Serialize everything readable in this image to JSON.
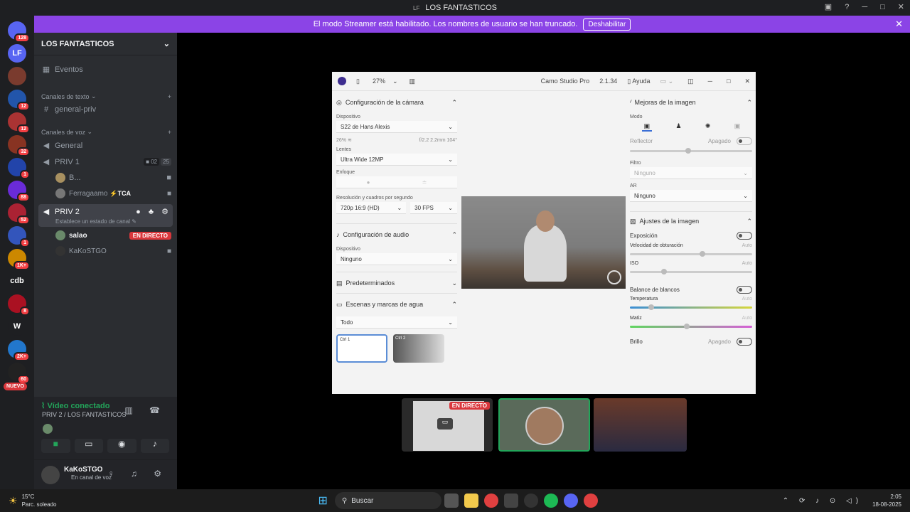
{
  "window": {
    "logo": "LF",
    "title": "LOS FANTASTICOS"
  },
  "banner": {
    "text": "El modo Streamer está habilitado. Los nombres de usuario se han truncado.",
    "button": "Deshabilitar"
  },
  "servers": [
    {
      "label": "",
      "badge": "128",
      "color": "#5865f2"
    },
    {
      "label": "LF",
      "badge": "",
      "color": "#5865f2"
    },
    {
      "label": "",
      "badge": "",
      "color": "#7a3b2e"
    },
    {
      "label": "",
      "badge": "12",
      "color": "#2255aa"
    },
    {
      "label": "",
      "badge": "12",
      "color": "#aa3333"
    },
    {
      "label": "",
      "badge": "32",
      "color": "#883322"
    },
    {
      "label": "",
      "badge": "1",
      "color": "#2244aa"
    },
    {
      "label": "",
      "badge": "88",
      "color": "#6a2bd8"
    },
    {
      "label": "",
      "badge": "52",
      "color": "#aa2233"
    },
    {
      "label": "",
      "badge": "1",
      "color": "#3355bb"
    },
    {
      "label": "",
      "badge": "1K+",
      "color": "#cc8800"
    },
    {
      "label": "cdb",
      "badge": "",
      "color": "#1e1f22"
    },
    {
      "label": "",
      "badge": "8",
      "color": "#aa1122"
    },
    {
      "label": "W",
      "badge": "",
      "color": "#1e1f22"
    },
    {
      "label": "",
      "badge": "2K+",
      "color": "#2277cc"
    },
    {
      "label": "",
      "badge": "60",
      "color": "#222"
    }
  ],
  "nuevo": "NUEVO",
  "sidebar": {
    "server_name": "LOS FANTASTICOS",
    "events": "Eventos",
    "text_cat": "Canales de texto",
    "text_channel": "general-priv",
    "voice_cat": "Canales de voz",
    "voice_general": "General",
    "priv1": "PRIV 1",
    "priv1_count": "02",
    "priv1_limit": "25",
    "priv1_user1": "B...",
    "priv1_user2": "Ferragaamo",
    "priv1_user2_tag": "TCA",
    "priv2": "PRIV 2",
    "priv2_status": "Establece un estado de canal",
    "priv2_user1": "salao",
    "live": "EN DIRECTO",
    "priv2_user2": "KaKoSTGO"
  },
  "voice_panel": {
    "status": "Vídeo conectado",
    "channel": "PRIV 2 / LOS FANTASTICOS"
  },
  "user": {
    "name": "KaKoSTGO",
    "status": "En canal de voz"
  },
  "camo": {
    "zoom": "27%",
    "app": "Camo Studio Pro",
    "version": "2.1.34",
    "help": "Ayuda",
    "camera_section": "Configuración de la cámara",
    "device_label": "Dispositivo",
    "device": "S22 de Hans Alexis",
    "battery": "26%",
    "optics": "f/2.2 2.2mm 104°",
    "lens_label": "Lentes",
    "lens": "Ultra Wide 12MP",
    "focus_label": "Enfoque",
    "res_label": "Resolución y cuadros por segundo",
    "resolution": "720p 16:9 (HD)",
    "fps": "30 FPS",
    "audio_section": "Configuración de audio",
    "audio_device_label": "Dispositivo",
    "audio_device": "Ninguno",
    "presets": "Predeterminados",
    "scenes": "Escenas y marcas de agua",
    "scenes_filter": "Todo",
    "scene1": "Ctrl 1",
    "scene2": "Ctrl 2",
    "enh_section": "Mejoras de la imagen",
    "mode_label": "Modo",
    "reflector": "Reflector",
    "off": "Apagado",
    "filter_label": "Filtro",
    "filter": "Ninguno",
    "ar_label": "AR",
    "ar": "Ninguno",
    "adj_section": "Ajustes de la imagen",
    "exposure": "Exposición",
    "shutter": "Velocidad de obturación",
    "auto": "Auto",
    "iso": "ISO",
    "wb": "Balance de blancos",
    "temp": "Temperatura",
    "tint": "Matiz",
    "brightness": "Brillo"
  },
  "thumb_live": "EN DIRECTO",
  "taskbar": {
    "weather_temp": "15°C",
    "weather_desc": "Parc. soleado",
    "search": "Buscar",
    "time": "2:05",
    "date": "18-08-2025"
  }
}
